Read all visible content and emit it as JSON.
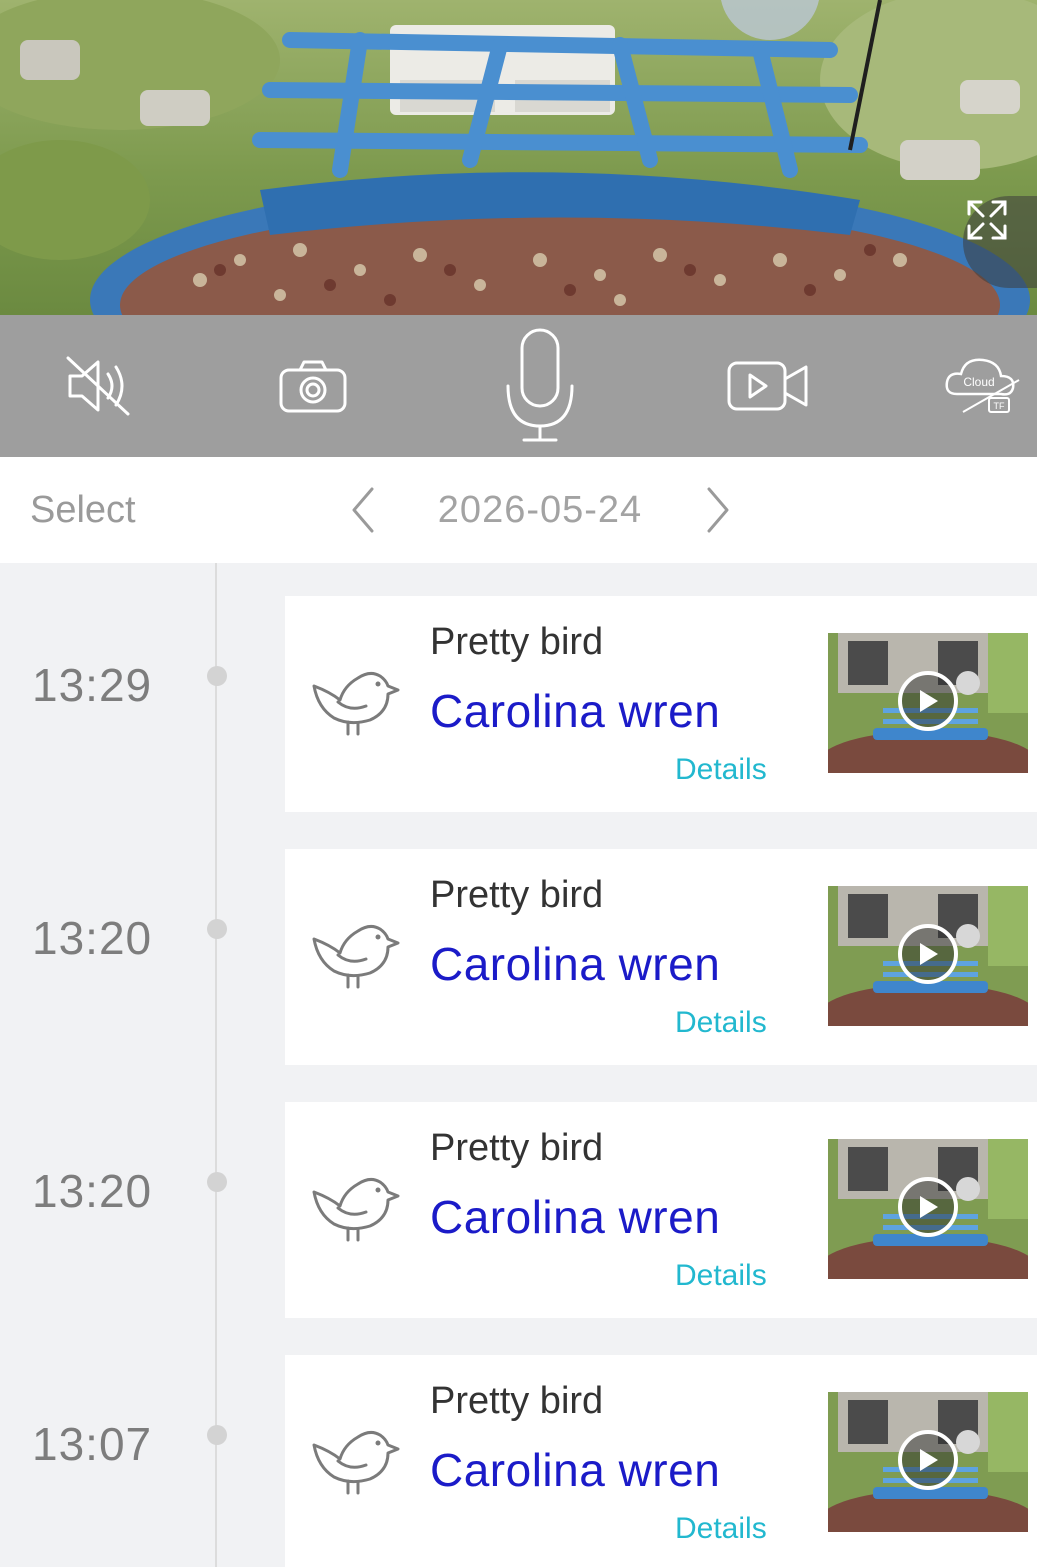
{
  "controls": {
    "mute": {
      "icon": "speaker-muted-icon"
    },
    "snapshot": {
      "icon": "camera-icon"
    },
    "talk": {
      "icon": "microphone-icon"
    },
    "record": {
      "icon": "video-camera-icon"
    },
    "storage": {
      "icon": "cloud-tf-icon",
      "cloud_label": "Cloud",
      "tf_label": "TF"
    }
  },
  "datebar": {
    "select_label": "Select",
    "date": "2026-05-24"
  },
  "events": [
    {
      "time": "13:29",
      "title": "Pretty bird",
      "species": "Carolina wren",
      "details_label": "Details"
    },
    {
      "time": "13:20",
      "title": "Pretty bird",
      "species": "Carolina wren",
      "details_label": "Details"
    },
    {
      "time": "13:20",
      "title": "Pretty bird",
      "species": "Carolina wren",
      "details_label": "Details"
    },
    {
      "time": "13:07",
      "title": "Pretty bird",
      "species": "Carolina wren",
      "details_label": "Details"
    }
  ],
  "colors": {
    "species_text": "#1b1bc8",
    "details_link": "#22b8cf",
    "control_bar": "#9e9e9e"
  }
}
